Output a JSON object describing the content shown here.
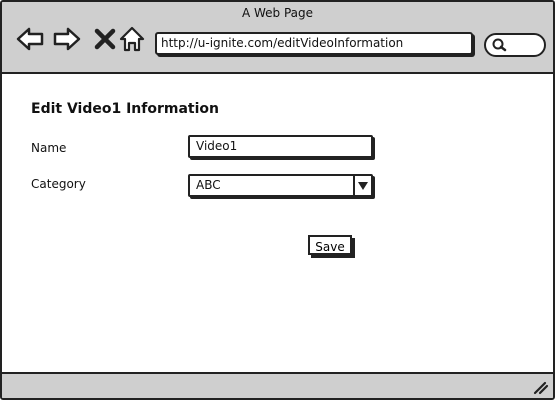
{
  "window": {
    "title": "A Web Page"
  },
  "toolbar": {
    "url": "http://u-ignite.com/editVideoInformation",
    "icons": [
      "back-arrow-icon",
      "forward-arrow-icon",
      "close-icon",
      "home-icon",
      "search-icon"
    ]
  },
  "form": {
    "heading": "Edit Video1 Information",
    "name_label": "Name",
    "name_value": "Video1",
    "category_label": "Category",
    "category_value": "ABC",
    "save_label": "Save"
  }
}
